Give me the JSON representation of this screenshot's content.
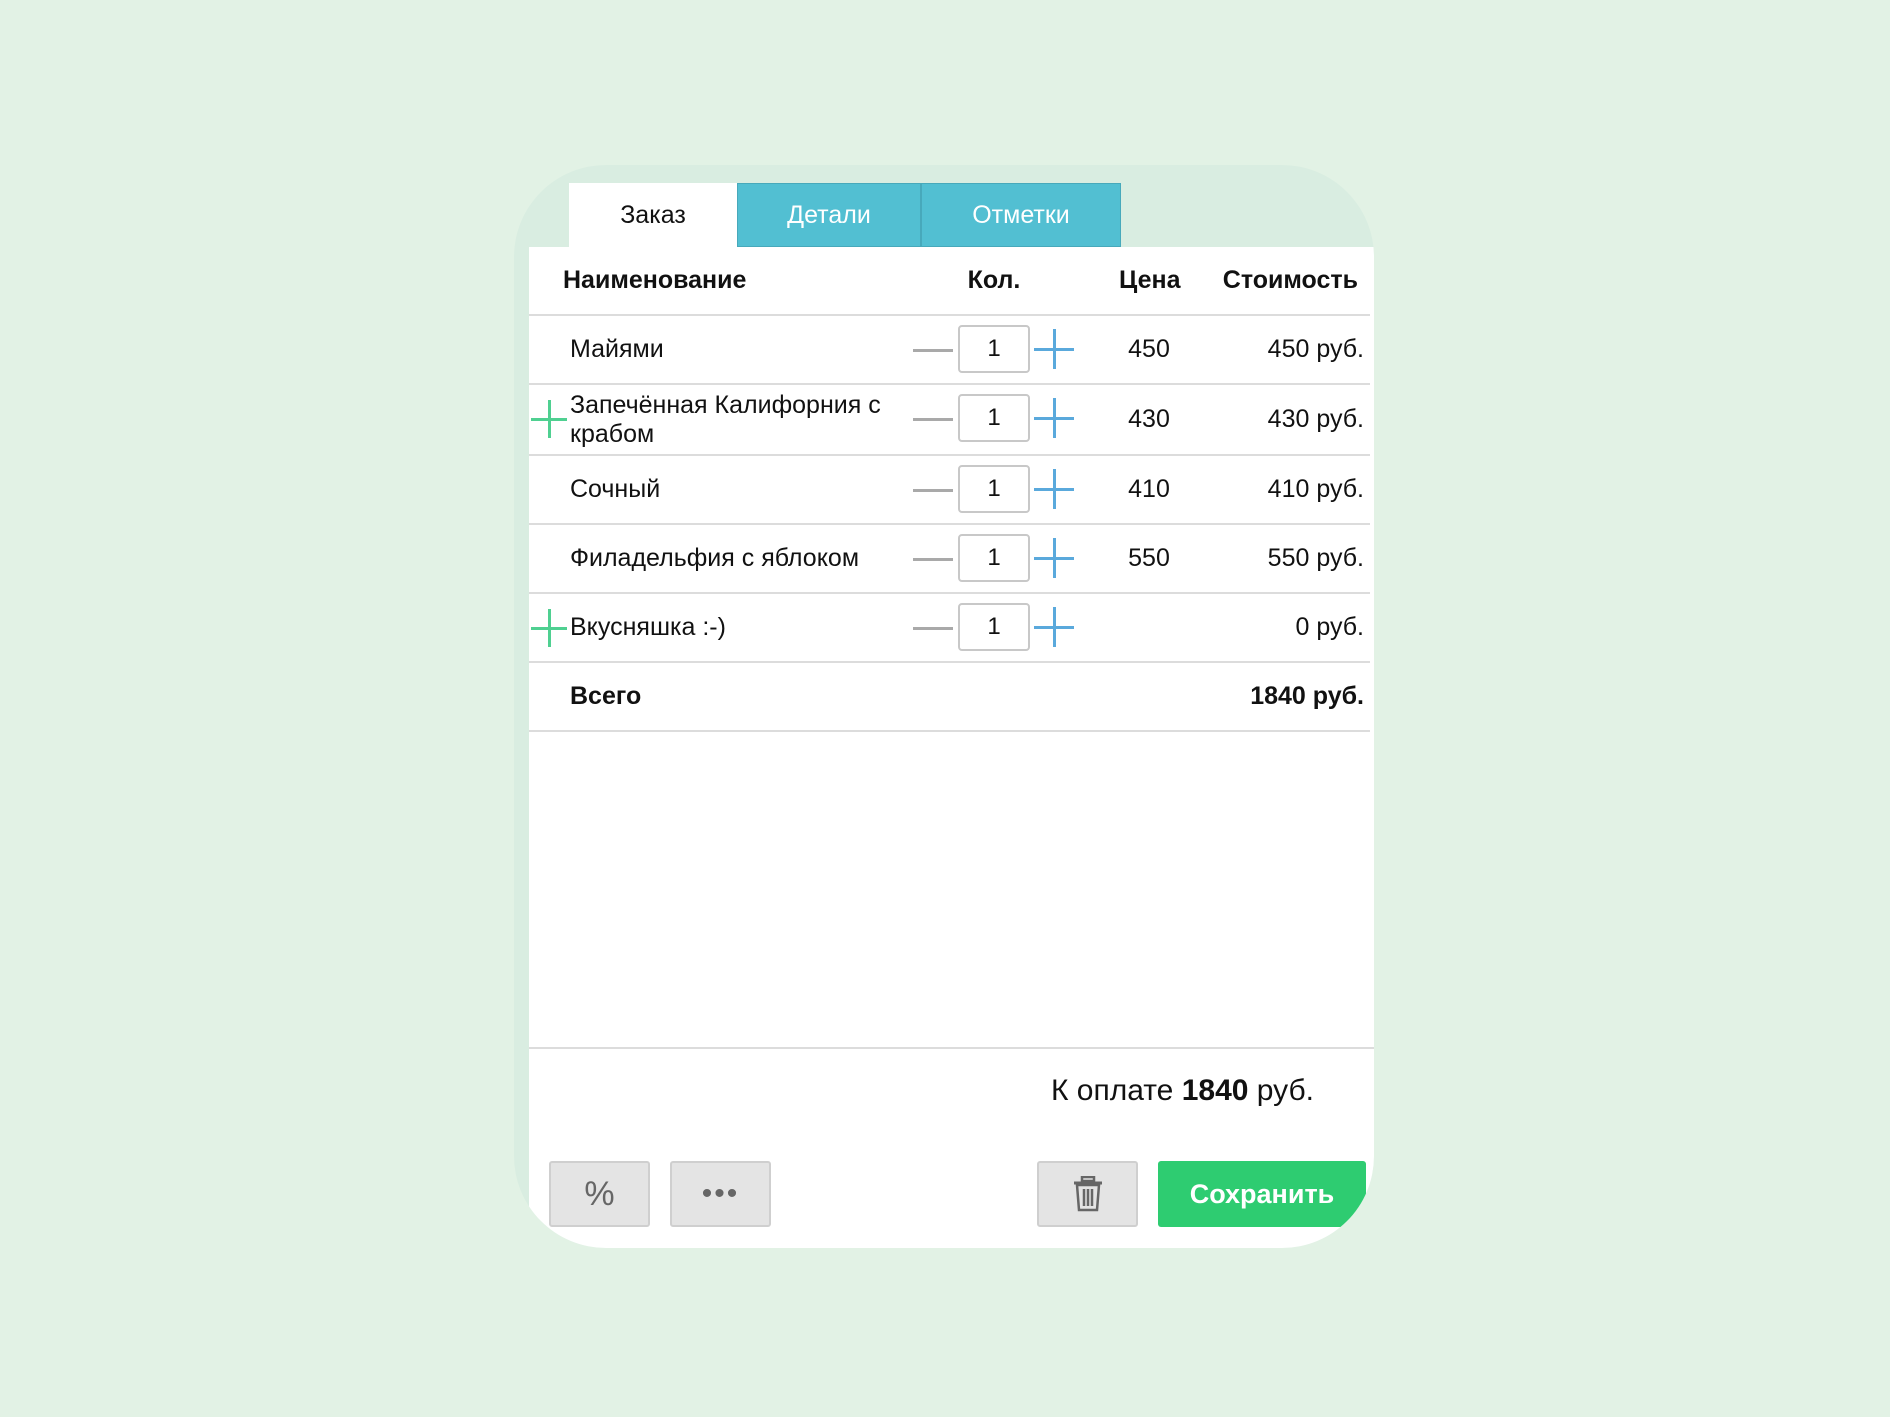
{
  "tabs": [
    {
      "label": "Заказ",
      "active": true
    },
    {
      "label": "Детали",
      "active": false
    },
    {
      "label": "Отметки",
      "active": false
    }
  ],
  "table": {
    "headers": {
      "name": "Наименование",
      "qty": "Кол.",
      "price": "Цена",
      "sum": "Стоимость"
    },
    "rows": [
      {
        "name": "Майями",
        "qty": "1",
        "price": "450",
        "sum": "450 руб.",
        "added": false
      },
      {
        "name": "Запечённая Калифорния с крабом",
        "qty": "1",
        "price": "430",
        "sum": "430 руб.",
        "added": true
      },
      {
        "name": "Сочный",
        "qty": "1",
        "price": "410",
        "sum": "410 руб.",
        "added": false
      },
      {
        "name": "Филадельфия с яблоком",
        "qty": "1",
        "price": "550",
        "sum": "550 руб.",
        "added": false
      },
      {
        "name": "Вкусняшка :-)",
        "qty": "1",
        "price": "",
        "sum": "0 руб.",
        "added": true
      }
    ],
    "total": {
      "label": "Всего",
      "value": "1840 руб."
    }
  },
  "payment": {
    "prefix": "К оплате",
    "amount": "1840",
    "suffix": "руб."
  },
  "buttons": {
    "discount_label": "%",
    "more_label": "•••",
    "save_label": "Сохранить",
    "trash_icon": "trash-icon"
  },
  "colors": {
    "background": "#e2f2e5",
    "tab_inactive": "#52bfd2",
    "plus_blue": "#5aa9dc",
    "added_green": "#4fd091",
    "save_green": "#2ecc71"
  }
}
